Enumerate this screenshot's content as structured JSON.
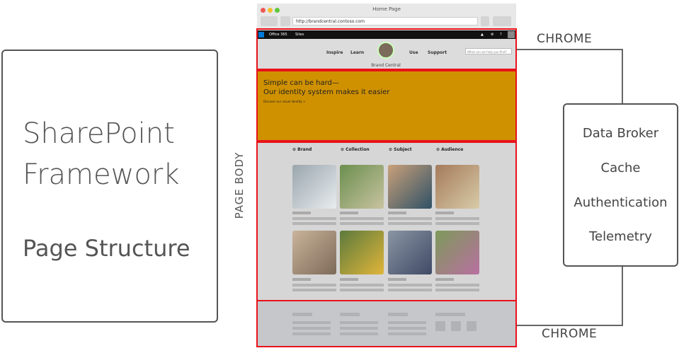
{
  "left_panel": {
    "title_line1": "SharePoint",
    "title_line2": "Framework",
    "subtitle": "Page Structure"
  },
  "page_body_label": "PAGE BODY",
  "browser": {
    "window_title": "Home Page",
    "url": "http://brandcentral.contoso.com",
    "suite_bar": {
      "app1": "Office 365",
      "app2": "Sites",
      "icons": [
        "bell-icon",
        "gear-icon",
        "help-icon"
      ]
    },
    "site_nav": [
      "Inspire",
      "Learn",
      "Use",
      "Support"
    ],
    "site_name": "Brand Central",
    "search_placeholder": "What can we help you find?",
    "hero": {
      "line1": "Simple can be hard—",
      "line2": "Our identity system makes it easier",
      "link": "Discover our visual identity >"
    },
    "categories": [
      "Brand",
      "Collection",
      "Subject",
      "Audience"
    ]
  },
  "chrome_top_label": "CHROME",
  "chrome_bottom_label": "CHROME",
  "services": [
    "Data Broker",
    "Cache",
    "Authentication",
    "Telemetry"
  ],
  "colors": {
    "outline": "#e8121a",
    "hero_bg": "#d09100",
    "suite_bar": "#111111"
  }
}
